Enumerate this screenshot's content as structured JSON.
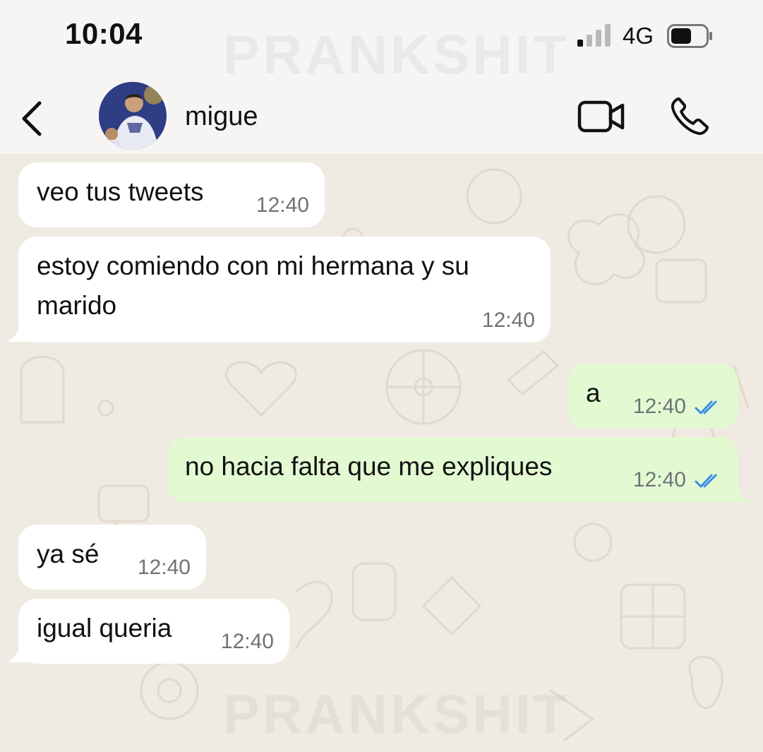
{
  "status_bar": {
    "time": "10:04",
    "network": "4G"
  },
  "header": {
    "contact_name": "migue"
  },
  "watermark": "PRANKSHIT",
  "messages": [
    {
      "direction": "in",
      "text": "veo tus tweets",
      "time": "12:40"
    },
    {
      "direction": "in",
      "text": "estoy comiendo con mi hermana y su marido",
      "time": "12:40"
    },
    {
      "direction": "out",
      "text": "a",
      "time": "12:40",
      "read": true
    },
    {
      "direction": "out",
      "text": "no hacia falta que me expliques",
      "time": "12:40",
      "read": true
    },
    {
      "direction": "in",
      "text": "ya sé",
      "time": "12:40"
    },
    {
      "direction": "in",
      "text": "igual queria",
      "time": "12:40"
    }
  ],
  "colors": {
    "incoming_bubble": "#ffffff",
    "outgoing_bubble": "#e2f9d2",
    "chat_background": "#efeae2",
    "read_ticks": "#3b8be8"
  },
  "icons": [
    "back-icon",
    "video-call-icon",
    "phone-icon",
    "signal-icon",
    "battery-icon",
    "double-check-icon"
  ]
}
